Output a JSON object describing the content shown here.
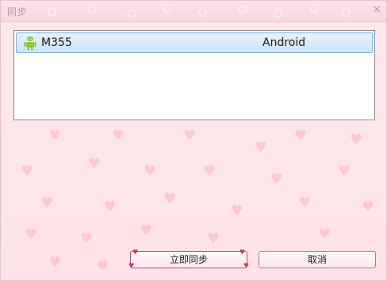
{
  "window": {
    "title": "同步",
    "close_symbol": "×"
  },
  "device_list": {
    "rows": [
      {
        "icon": "android-icon",
        "name": "M355",
        "os": "Android"
      }
    ]
  },
  "buttons": {
    "sync_label": "立即同步",
    "cancel_label": "取消"
  },
  "colors": {
    "background": "#ffe4e8",
    "selection": "#cfe5fc",
    "android_green": "#8cc63f"
  }
}
